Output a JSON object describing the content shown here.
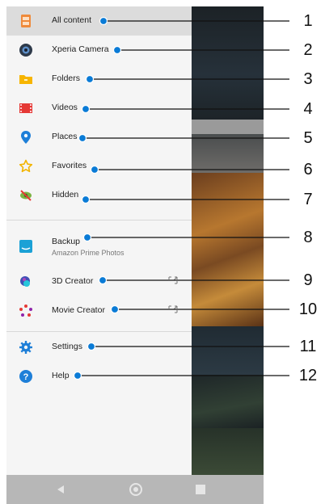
{
  "menu": {
    "items": [
      {
        "label": "All content",
        "icon": "all-content-icon",
        "active": true
      },
      {
        "label": "Xperia Camera",
        "icon": "camera-icon"
      },
      {
        "label": "Folders",
        "icon": "folder-icon"
      },
      {
        "label": "Videos",
        "icon": "video-icon"
      },
      {
        "label": "Places",
        "icon": "place-pin-icon"
      },
      {
        "label": "Favorites",
        "icon": "star-icon"
      },
      {
        "label": "Hidden",
        "icon": "hidden-eye-icon"
      },
      {
        "label": "Backup",
        "sublabel": "Amazon Prime Photos",
        "icon": "amazon-photos-icon"
      },
      {
        "label": "3D Creator",
        "icon": "3d-creator-icon",
        "external": true
      },
      {
        "label": "Movie Creator",
        "icon": "movie-creator-icon",
        "external": true
      },
      {
        "label": "Settings",
        "icon": "gear-icon"
      },
      {
        "label": "Help",
        "icon": "help-icon"
      }
    ]
  },
  "callouts": [
    "1",
    "2",
    "3",
    "4",
    "5",
    "6",
    "7",
    "8",
    "9",
    "10",
    "11",
    "12"
  ],
  "colors": {
    "accent": "#0a7bd6",
    "drawer_bg": "#f5f5f5",
    "active_bg": "#dcdcdc",
    "navbar": "#b7b7b7"
  }
}
